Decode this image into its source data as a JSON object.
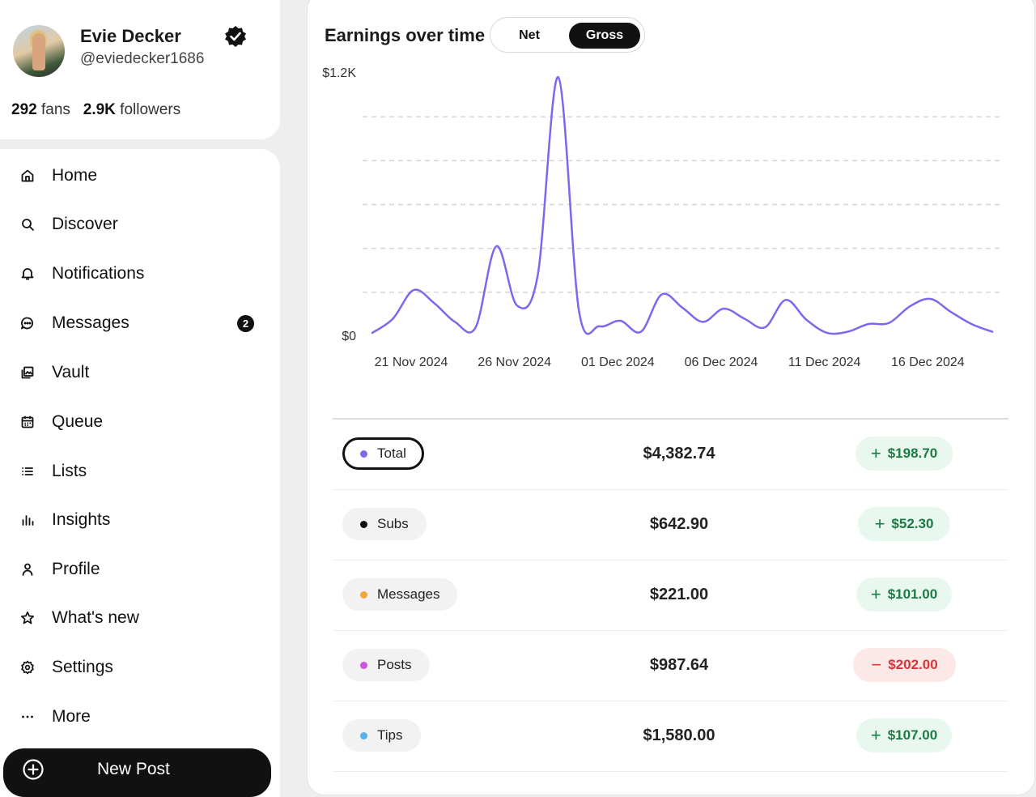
{
  "profile": {
    "name": "Evie Decker",
    "handle": "@eviedecker1686",
    "fans_count": "292",
    "fans_label": "fans",
    "followers_count": "2.9K",
    "followers_label": "followers"
  },
  "nav": {
    "items": [
      {
        "label": "Home",
        "icon": "home-icon"
      },
      {
        "label": "Discover",
        "icon": "search-icon"
      },
      {
        "label": "Notifications",
        "icon": "bell-icon"
      },
      {
        "label": "Messages",
        "icon": "chat-bubble-icon",
        "badge": "2"
      },
      {
        "label": "Vault",
        "icon": "vault-icon"
      },
      {
        "label": "Queue",
        "icon": "calendar-icon"
      },
      {
        "label": "Lists",
        "icon": "list-icon"
      },
      {
        "label": "Insights",
        "icon": "bar-chart-icon"
      },
      {
        "label": "Profile",
        "icon": "user-icon"
      },
      {
        "label": "What's new",
        "icon": "star-icon"
      },
      {
        "label": "Settings",
        "icon": "gear-icon"
      },
      {
        "label": "More",
        "icon": "ellipsis-icon"
      }
    ],
    "new_post_label": "New Post"
  },
  "earnings": {
    "title": "Earnings over time",
    "toggle": {
      "net_label": "Net",
      "gross_label": "Gross",
      "selected": "Gross"
    },
    "rows": [
      {
        "label": "Total",
        "color": "#7b68ee",
        "amount": "$4,382.74",
        "change": "$198.70",
        "direction": "up",
        "active": true
      },
      {
        "label": "Subs",
        "color": "#111111",
        "amount": "$642.90",
        "change": "$52.30",
        "direction": "up",
        "active": false
      },
      {
        "label": "Messages",
        "color": "#f4a63b",
        "amount": "$221.00",
        "change": "$101.00",
        "direction": "up",
        "active": false
      },
      {
        "label": "Posts",
        "color": "#d451e8",
        "amount": "$987.64",
        "change": "$202.00",
        "direction": "down",
        "active": false
      },
      {
        "label": "Tips",
        "color": "#58b0ef",
        "amount": "$1,580.00",
        "change": "$107.00",
        "direction": "up",
        "active": false
      }
    ]
  },
  "chart_data": {
    "type": "line",
    "title": "Earnings over time",
    "ytick_labels": [
      "$0",
      "$1.2K"
    ],
    "ylim": [
      0,
      1200
    ],
    "xtick_labels": [
      "21 Nov 2024",
      "26 Nov 2024",
      "01 Dec 2024",
      "06 Dec 2024",
      "11 Dec 2024",
      "16 Dec 2024"
    ],
    "grid": true,
    "series": [
      {
        "color": "#7b68ee",
        "x": [
          "2024-11-21",
          "2024-11-22",
          "2024-11-23",
          "2024-11-24",
          "2024-11-25",
          "2024-11-26",
          "2024-11-27",
          "2024-11-28",
          "2024-11-29",
          "2024-11-30",
          "2024-12-01",
          "2024-12-02",
          "2024-12-03",
          "2024-12-04",
          "2024-12-05",
          "2024-12-06",
          "2024-12-07",
          "2024-12-08",
          "2024-12-09",
          "2024-12-10",
          "2024-12-11",
          "2024-12-12",
          "2024-12-13",
          "2024-12-14",
          "2024-12-15",
          "2024-12-16",
          "2024-12-17",
          "2024-12-18",
          "2024-12-19",
          "2024-12-20",
          "2024-12-21"
        ],
        "y": [
          15,
          80,
          210,
          150,
          65,
          40,
          410,
          140,
          275,
          1180,
          115,
          45,
          70,
          20,
          190,
          130,
          65,
          125,
          80,
          40,
          165,
          75,
          15,
          20,
          55,
          60,
          135,
          170,
          110,
          55,
          20
        ]
      }
    ]
  }
}
